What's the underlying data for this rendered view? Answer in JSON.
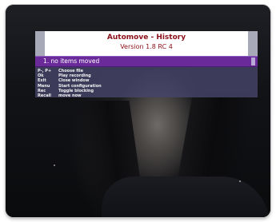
{
  "dialog": {
    "title": "Automove - History",
    "version": "Version 1.8 RC 4",
    "selected_item": "1. no items moved"
  },
  "help": [
    {
      "key": "P-, P+",
      "desc": "Choose file"
    },
    {
      "key": "Ok",
      "desc": "Play recording"
    },
    {
      "key": "Exit",
      "desc": "Close window"
    },
    {
      "key": "Menu",
      "desc": "Start configuration"
    },
    {
      "key": "Rec",
      "desc": "Toggle blocking"
    },
    {
      "key": "Recall",
      "desc": "move now"
    }
  ],
  "colors": {
    "title": "#8a0f18",
    "selection_bar": "#6a2a9a",
    "help_panel": "#464469",
    "header_side": "#a7a9b8"
  }
}
